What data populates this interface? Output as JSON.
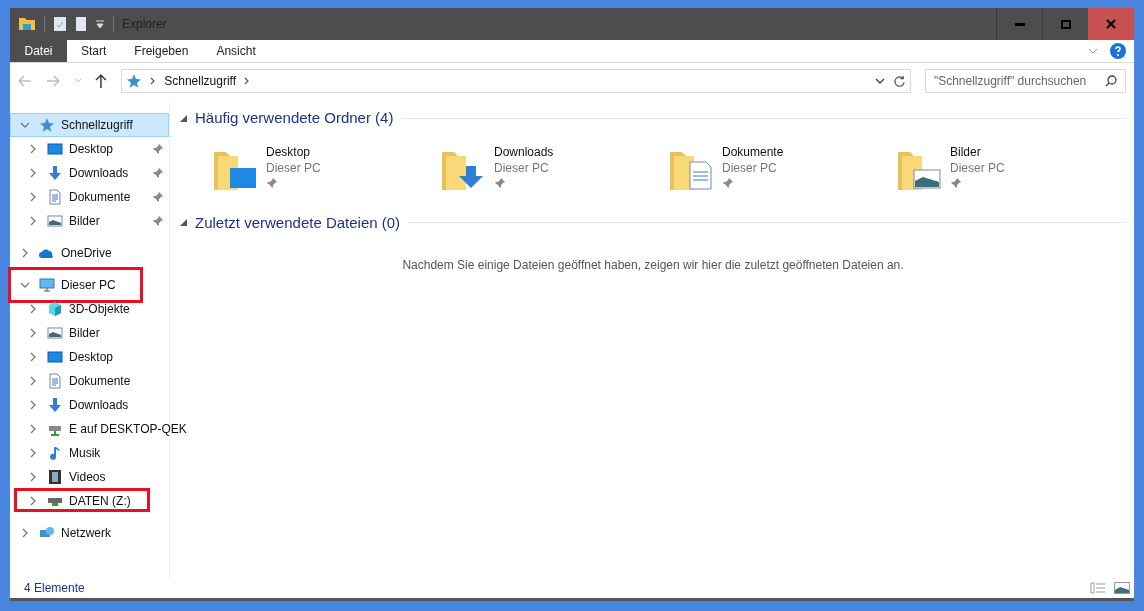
{
  "window": {
    "title": "Explorer"
  },
  "ribbon_tabs": [
    {
      "label": "Datei",
      "selected": true
    },
    {
      "label": "Start",
      "selected": false
    },
    {
      "label": "Freigeben",
      "selected": false
    },
    {
      "label": "Ansicht",
      "selected": false
    }
  ],
  "address_bar": {
    "path": [
      "Schnellzugriff"
    ]
  },
  "search": {
    "placeholder": "\"Schnellzugriff\" durchsuchen"
  },
  "navigation_tree": [
    {
      "label": "Schnellzugriff",
      "kind": "star",
      "expanded": true,
      "selected": true,
      "highlighted": false,
      "children": [
        {
          "label": "Desktop",
          "kind": "desktop",
          "pinned": true
        },
        {
          "label": "Downloads",
          "kind": "download",
          "pinned": true
        },
        {
          "label": "Dokumente",
          "kind": "document",
          "pinned": true
        },
        {
          "label": "Bilder",
          "kind": "picture",
          "pinned": true
        }
      ]
    },
    {
      "label": "OneDrive",
      "kind": "cloud",
      "expanded": false,
      "selected": false,
      "highlighted": false
    },
    {
      "label": "Dieser PC",
      "kind": "monitor",
      "expanded": true,
      "selected": false,
      "highlighted": true,
      "children": [
        {
          "label": "3D-Objekte",
          "kind": "cube",
          "pinned": false,
          "highlighted": false
        },
        {
          "label": "Bilder",
          "kind": "picture",
          "pinned": false,
          "highlighted": false
        },
        {
          "label": "Desktop",
          "kind": "desktop",
          "pinned": false,
          "highlighted": false
        },
        {
          "label": "Dokumente",
          "kind": "document",
          "pinned": false,
          "highlighted": false
        },
        {
          "label": "Downloads",
          "kind": "download",
          "pinned": false,
          "highlighted": false
        },
        {
          "label": "E auf DESKTOP-QEK",
          "kind": "netdrive",
          "pinned": false,
          "highlighted": false
        },
        {
          "label": "Musik",
          "kind": "music",
          "pinned": false,
          "highlighted": false
        },
        {
          "label": "Videos",
          "kind": "film",
          "pinned": false,
          "highlighted": false
        },
        {
          "label": "DATEN (Z:)",
          "kind": "drive",
          "pinned": false,
          "highlighted": true
        }
      ]
    },
    {
      "label": "Netzwerk",
      "kind": "network",
      "expanded": false,
      "selected": false,
      "highlighted": false
    }
  ],
  "sections": [
    {
      "title": "Häufig verwendete Ordner (4)",
      "expanded": true,
      "folders": [
        {
          "name": "Desktop",
          "location": "Dieser PC",
          "kind": "desktop",
          "pinned": true
        },
        {
          "name": "Downloads",
          "location": "Dieser PC",
          "kind": "download",
          "pinned": true
        },
        {
          "name": "Dokumente",
          "location": "Dieser PC",
          "kind": "document",
          "pinned": true
        },
        {
          "name": "Bilder",
          "location": "Dieser PC",
          "kind": "picture",
          "pinned": true
        }
      ]
    },
    {
      "title": "Zuletzt verwendete Dateien (0)",
      "expanded": true,
      "empty_message": "Nachdem Sie einige Dateien geöffnet haben, zeigen wir hier die zuletzt geöffneten Dateien an."
    }
  ],
  "status_bar": {
    "item_count": "4 Elemente"
  }
}
